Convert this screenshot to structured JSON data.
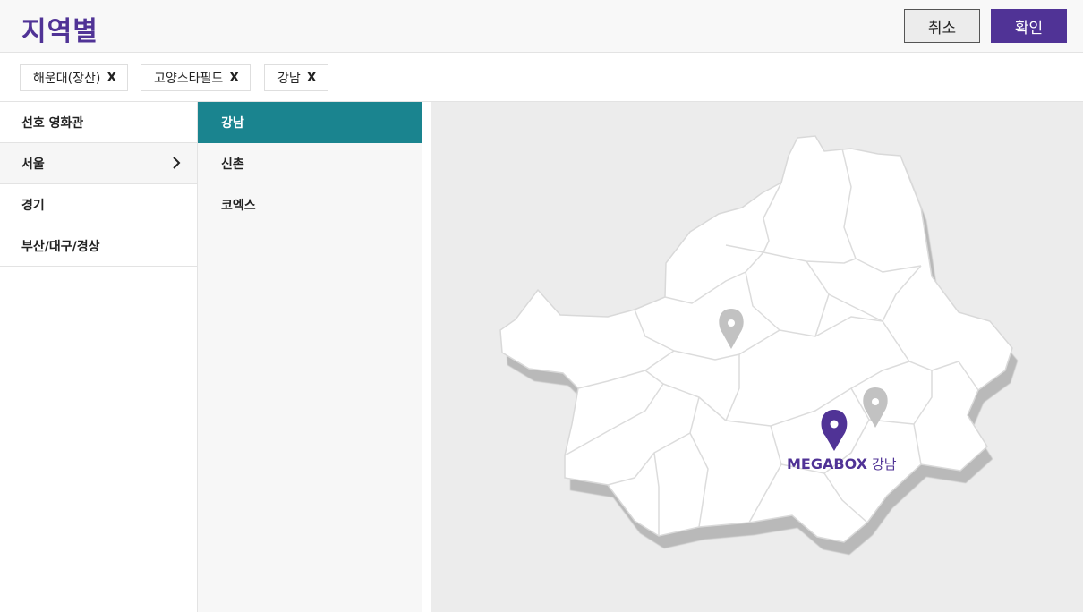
{
  "header": {
    "title": "지역별",
    "cancel_label": "취소",
    "confirm_label": "확인"
  },
  "selected_chips": [
    {
      "label": "해운대(장산)",
      "remove": "X"
    },
    {
      "label": "고양스타필드",
      "remove": "X"
    },
    {
      "label": "강남",
      "remove": "X"
    }
  ],
  "regions": [
    {
      "label": "선호 영화관"
    },
    {
      "label": "서울"
    },
    {
      "label": "경기"
    },
    {
      "label": "부산/대구/경상"
    }
  ],
  "theaters": [
    {
      "label": "강남"
    },
    {
      "label": "신촌"
    },
    {
      "label": "코엑스"
    }
  ],
  "map": {
    "brand": "MEGABOX",
    "selected_theater": "강남"
  },
  "colors": {
    "brand_purple": "#503396",
    "active_teal": "#1a848f",
    "map_bg": "#ececec",
    "pin_inactive": "#bdbdbd"
  },
  "icons": [
    "chevron-right-icon",
    "map-pin-icon"
  ]
}
